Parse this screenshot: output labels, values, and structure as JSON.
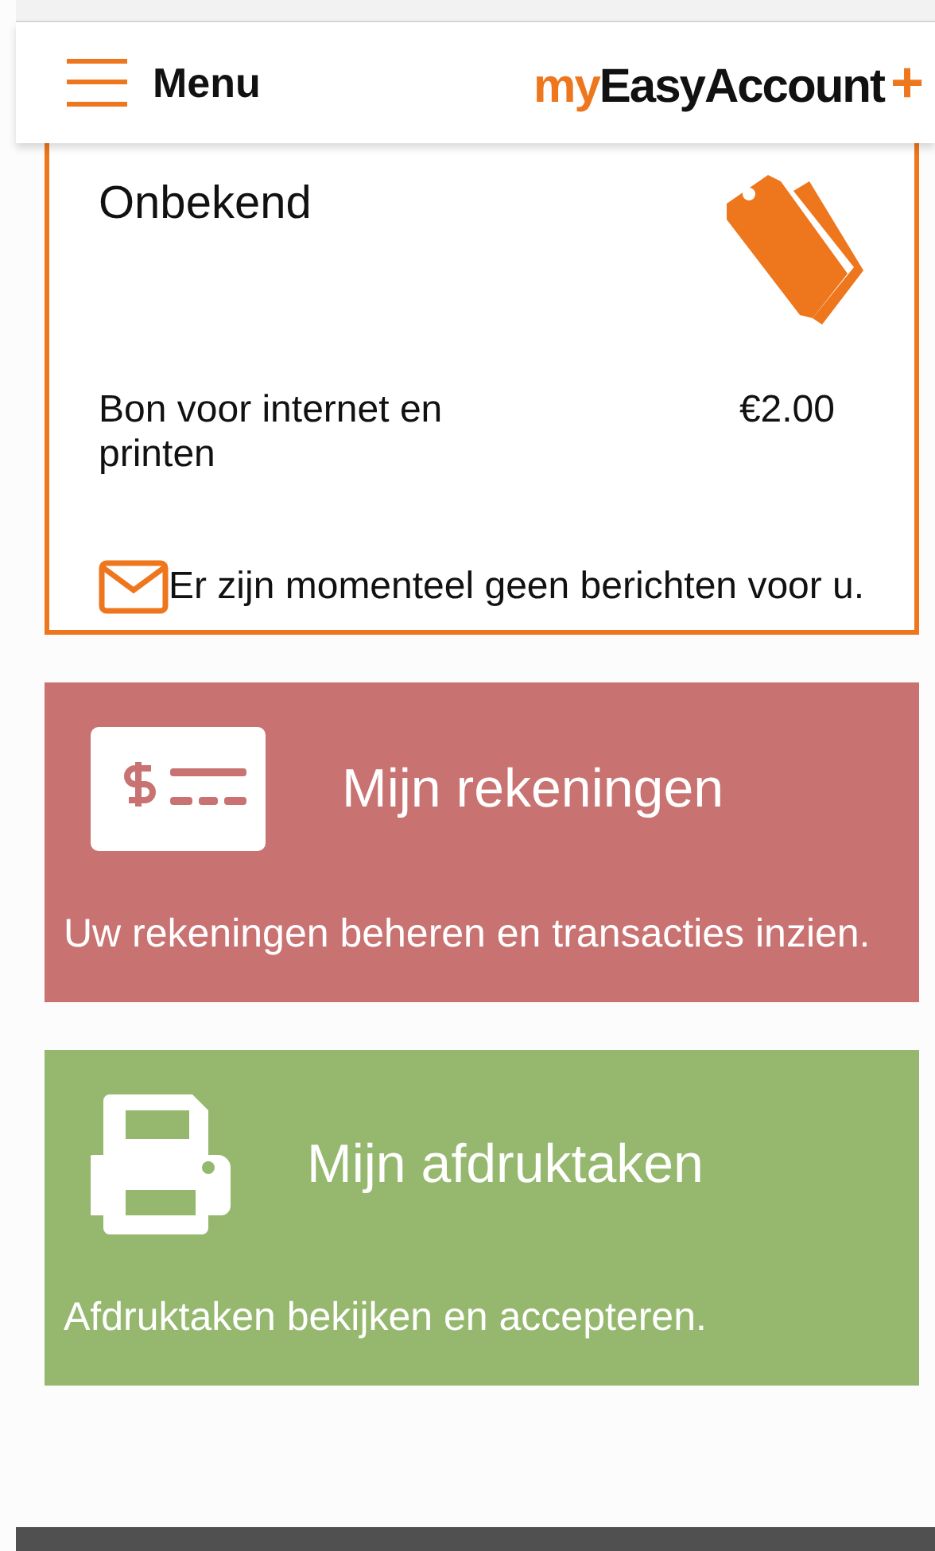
{
  "header": {
    "menu_label": "Menu",
    "logo": {
      "prefix": "my",
      "name": "EasyAccount",
      "mark": "+"
    }
  },
  "account_card": {
    "status": "Onbekend",
    "product": "Bon voor internet en printen",
    "balance": "€2.00",
    "message": "Er zijn momenteel geen berichten voor u."
  },
  "tiles": [
    {
      "kind": "accounts",
      "color": "#c97272",
      "title": "Mijn rekeningen",
      "description": "Uw rekeningen beheren en transacties inzien."
    },
    {
      "kind": "print",
      "color": "#95b86e",
      "title": "Mijn afdruktaken",
      "description": "Afdruktaken bekijken en accepteren."
    }
  ]
}
